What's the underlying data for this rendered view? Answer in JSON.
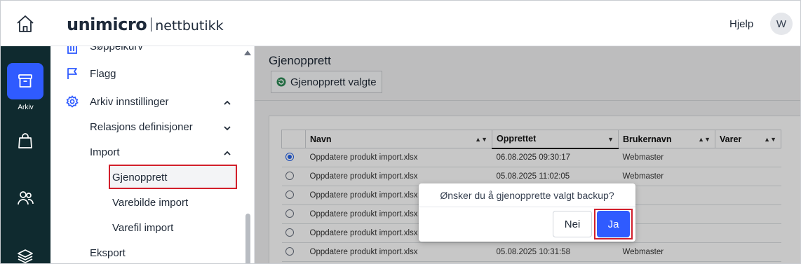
{
  "header": {
    "logo_main": "unimicro",
    "logo_sub": "nettbutikk",
    "help_label": "Hjelp",
    "avatar_initial": "W"
  },
  "rail": {
    "active_label": "Arkiv"
  },
  "sidebar": {
    "items": [
      {
        "label": "Søppelkurv"
      },
      {
        "label": "Flagg"
      },
      {
        "label": "Arkiv innstillinger"
      },
      {
        "label": "Relasjons definisjoner"
      },
      {
        "label": "Import"
      },
      {
        "label": "Gjenopprett"
      },
      {
        "label": "Varebilde import"
      },
      {
        "label": "Varefil import"
      },
      {
        "label": "Eksport"
      }
    ]
  },
  "main": {
    "title": "Gjenopprett",
    "restore_button": "Gjenopprett valgte",
    "table": {
      "columns": [
        "Navn",
        "Opprettet",
        "Brukernavn",
        "Varer"
      ],
      "rows": [
        {
          "name": "Oppdatere produkt import.xlsx",
          "created": "06.08.2025 09:30:17",
          "user": "Webmaster",
          "items": "",
          "selected": true
        },
        {
          "name": "Oppdatere produkt import.xlsx",
          "created": "05.08.2025 11:02:05",
          "user": "Webmaster",
          "items": "",
          "selected": false
        },
        {
          "name": "Oppdatere produkt import.xlsx",
          "created": "",
          "user": "",
          "items": "",
          "selected": false
        },
        {
          "name": "Oppdatere produkt import.xlsx",
          "created": "",
          "user": "",
          "items": "",
          "selected": false
        },
        {
          "name": "Oppdatere produkt import.xlsx",
          "created": "",
          "user": "",
          "items": "",
          "selected": false
        },
        {
          "name": "Oppdatere produkt import.xlsx",
          "created": "05.08.2025 10:31:58",
          "user": "Webmaster",
          "items": "",
          "selected": false
        }
      ]
    }
  },
  "dialog": {
    "message": "Ønsker du å gjenopprette valgt backup?",
    "no_label": "Nei",
    "yes_label": "Ja"
  },
  "colors": {
    "accent": "#2f5bff",
    "rail_bg": "#0f2a2f",
    "highlight": "#d21f2b"
  }
}
